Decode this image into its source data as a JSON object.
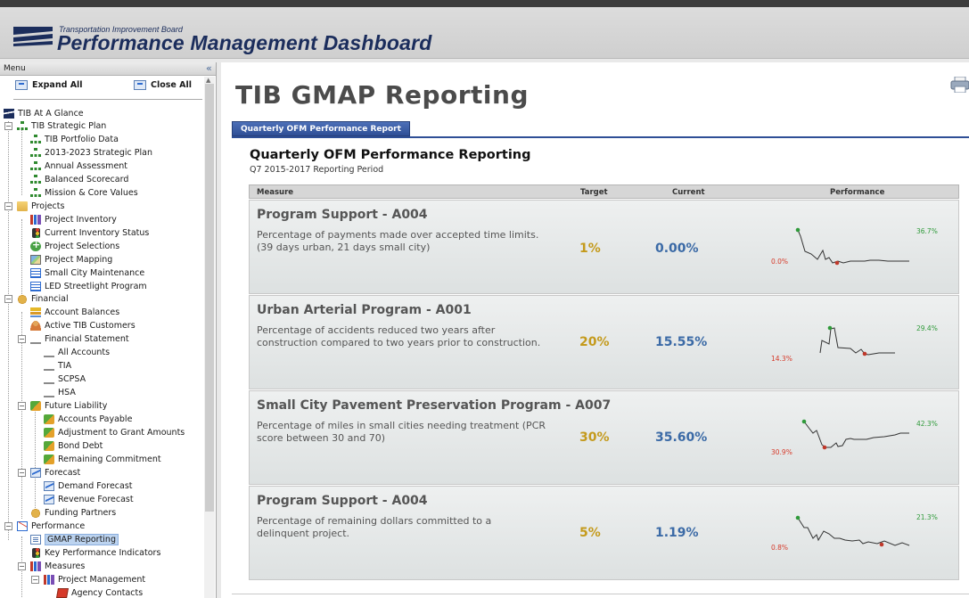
{
  "header": {
    "agency": "Transportation Improvement Board",
    "app_title": "Performance Management Dashboard"
  },
  "sidebar": {
    "menu_title": "Menu",
    "collapse_glyph": "«",
    "expand_all": "Expand All",
    "close_all": "Close All",
    "tree": [
      {
        "label": "TIB At A Glance",
        "icon": "tib-logo-icon"
      },
      {
        "label": "TIB Strategic Plan",
        "icon": "org-chart-icon"
      },
      {
        "label": "TIB Portfolio Data",
        "icon": "org-chart-icon"
      },
      {
        "label": "2013-2023 Strategic Plan",
        "icon": "org-chart-icon"
      },
      {
        "label": "Annual Assessment",
        "icon": "org-chart-icon"
      },
      {
        "label": "Balanced Scorecard",
        "icon": "org-chart-icon"
      },
      {
        "label": "Mission & Core Values",
        "icon": "org-chart-icon"
      },
      {
        "label": "Projects",
        "icon": "folder-icon"
      },
      {
        "label": "Project Inventory",
        "icon": "bar-chart-icon"
      },
      {
        "label": "Current Inventory Status",
        "icon": "traffic-light-icon"
      },
      {
        "label": "Project Selections",
        "icon": "add-circle-icon"
      },
      {
        "label": "Project Mapping",
        "icon": "map-icon"
      },
      {
        "label": "Small City Maintenance",
        "icon": "table-icon"
      },
      {
        "label": "LED Streetlight Program",
        "icon": "table-icon"
      },
      {
        "label": "Financial",
        "icon": "money-icon"
      },
      {
        "label": "Account Balances",
        "icon": "coins-icon"
      },
      {
        "label": "Active TIB Customers",
        "icon": "user-icon"
      },
      {
        "label": "Financial Statement",
        "icon": "bank-icon"
      },
      {
        "label": "All Accounts",
        "icon": "bank-icon"
      },
      {
        "label": "TIA",
        "icon": "bank-icon"
      },
      {
        "label": "SCPSA",
        "icon": "bank-icon"
      },
      {
        "label": "HSA",
        "icon": "bank-icon"
      },
      {
        "label": "Future Liability",
        "icon": "liability-icon"
      },
      {
        "label": "Accounts Payable",
        "icon": "liability-icon"
      },
      {
        "label": "Adjustment to Grant Amounts",
        "icon": "liability-icon"
      },
      {
        "label": "Bond Debt",
        "icon": "liability-icon"
      },
      {
        "label": "Remaining Commitment",
        "icon": "liability-icon"
      },
      {
        "label": "Forecast",
        "icon": "line-chart-icon"
      },
      {
        "label": "Demand Forecast",
        "icon": "line-chart-icon"
      },
      {
        "label": "Revenue Forecast",
        "icon": "line-chart-icon"
      },
      {
        "label": "Funding Partners",
        "icon": "money-icon"
      },
      {
        "label": "Performance",
        "icon": "performance-icon"
      },
      {
        "label": "GMAP Reporting",
        "icon": "document-icon"
      },
      {
        "label": "Key Performance Indicators",
        "icon": "traffic-light-icon"
      },
      {
        "label": "Measures",
        "icon": "bar-chart-icon"
      },
      {
        "label": "Project Management",
        "icon": "bar-chart-icon"
      },
      {
        "label": "Agency Contacts",
        "icon": "card-icon"
      }
    ]
  },
  "main": {
    "page_title": "TIB GMAP Reporting",
    "tab_label": "Quarterly OFM Performance Report",
    "report_title": "Quarterly OFM Performance Reporting",
    "report_period": "Q7 2015-2017 Reporting Period",
    "columns": {
      "measure": "Measure",
      "target": "Target",
      "current": "Current",
      "performance": "Performance"
    },
    "rows": [
      {
        "title": "Program Support - A004",
        "description": "Percentage of payments made over accepted time limits. (39 days urban, 21 days small city)",
        "target": "1%",
        "current": "0.00%",
        "spark_max": "36.7%",
        "spark_min": "0.0%"
      },
      {
        "title": "Urban Arterial Program - A001",
        "description": "Percentage of accidents reduced two years after construction compared to two years prior to construction.",
        "target": "20%",
        "current": "15.55%",
        "spark_max": "29.4%",
        "spark_min": "14.3%"
      },
      {
        "title": "Small City Pavement Preservation Program - A007",
        "description": "Percentage of miles in small cities needing treatment (PCR score between 30 and 70)",
        "target": "30%",
        "current": "35.60%",
        "spark_max": "42.3%",
        "spark_min": "30.9%"
      },
      {
        "title": "Program Support - A004",
        "description": "Percentage of remaining dollars committed to a delinquent project.",
        "target": "5%",
        "current": "1.19%",
        "spark_max": "21.3%",
        "spark_min": "0.8%"
      }
    ]
  },
  "colors": {
    "brand_navy": "#1b2d5c",
    "tab_blue": "#2f4f96",
    "target_gold": "#c49a1c",
    "current_blue": "#3b6aa6",
    "spark_high": "#2f9a3a",
    "spark_low": "#d63a2a"
  }
}
